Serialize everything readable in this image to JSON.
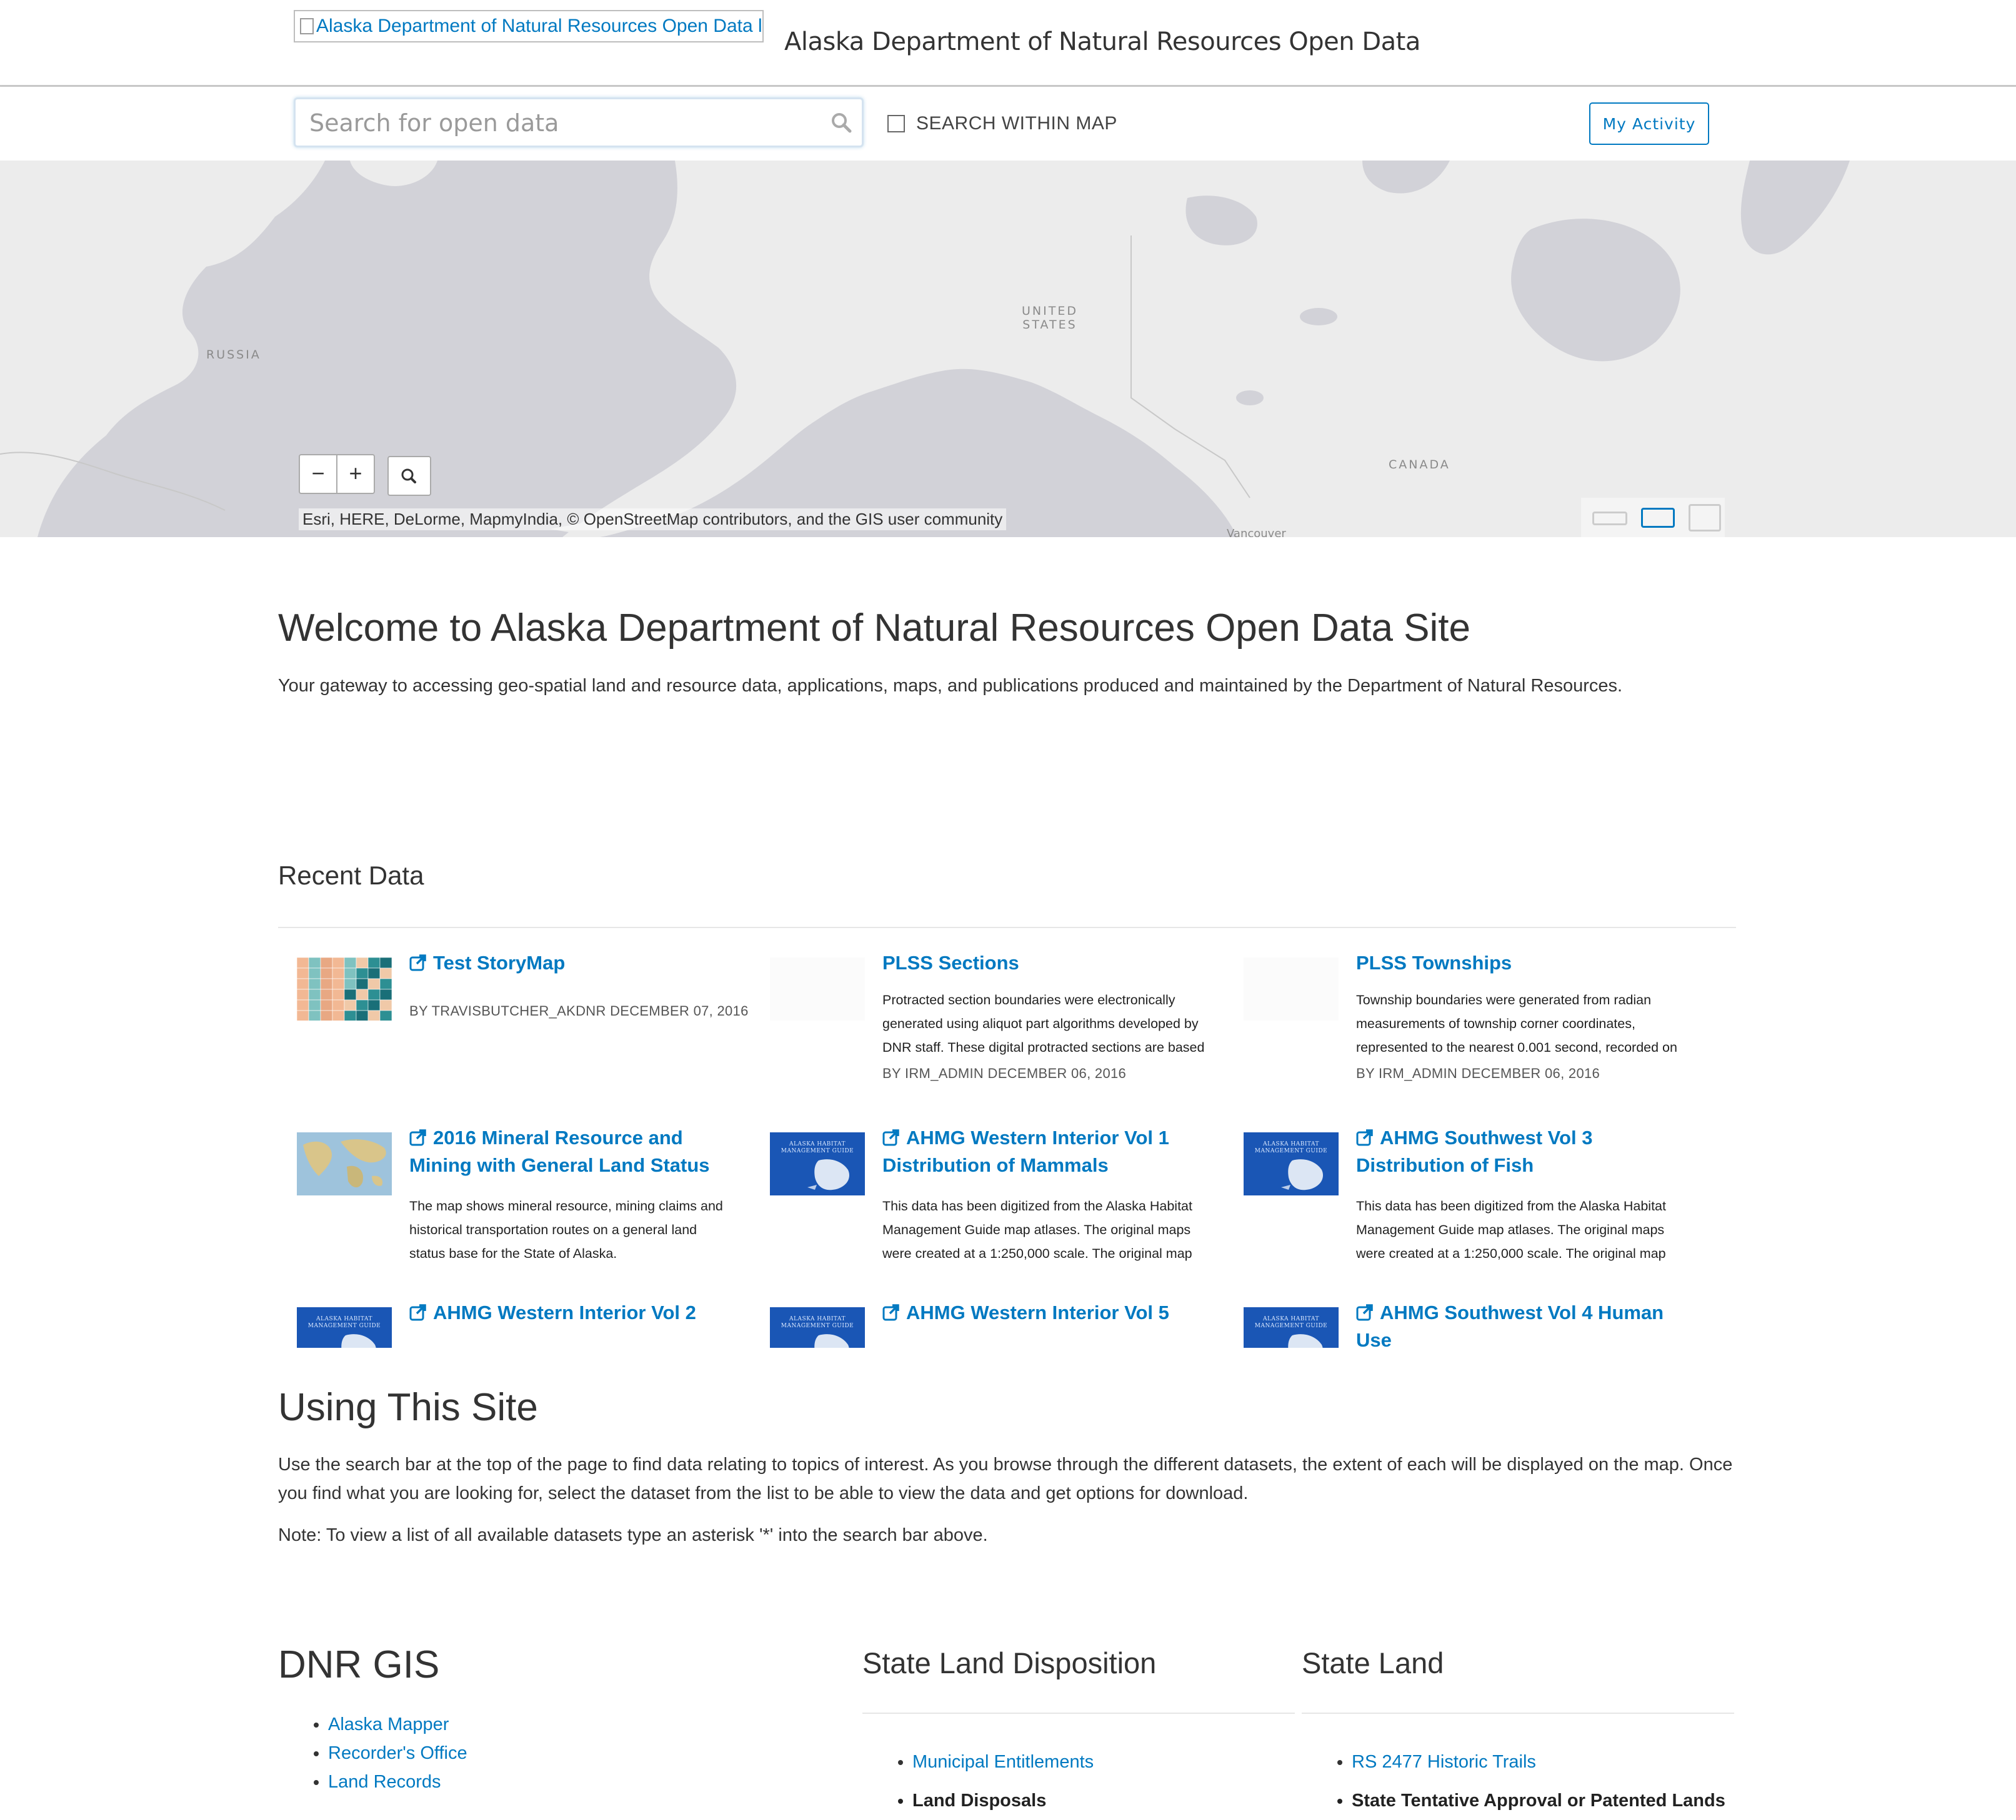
{
  "header": {
    "logo_alt": "Alaska Department of Natural Resources Open Data logo",
    "site_title": "Alaska Department of Natural Resources Open Data"
  },
  "search": {
    "placeholder": "Search for open data",
    "within_map_label": "SEARCH WITHIN MAP",
    "within_map_checked": false,
    "my_activity_label": "My Activity"
  },
  "map": {
    "labels": {
      "russia": "RUSSIA",
      "united_states": "UNITED STATES",
      "canada": "CANADA",
      "vancouver": "Vancouver"
    },
    "zoom_out": "−",
    "zoom_in": "+",
    "attribution": "Esri, HERE, DeLorme, MapmyIndia, © OpenStreetMap contributors, and the GIS user community",
    "water_color": "#d2d2d8",
    "land_color": "#ececec"
  },
  "welcome": {
    "title": "Welcome to Alaska Department of Natural Resources Open Data Site",
    "text": "Your gateway to accessing geo-spatial land and resource data, applications, maps, and publications produced and maintained by the Department of Natural Resources."
  },
  "recent": {
    "title": "Recent Data",
    "items": [
      {
        "title": "Test StoryMap",
        "description": "",
        "meta": "BY TRAVISBUTCHER_AKDNR DECEMBER 07, 2016",
        "thumb": "storymap",
        "external": true
      },
      {
        "title": "PLSS Sections",
        "description": "Protracted section boundaries were electronically generated using aliquot part algorithms developed by DNR staff. These digital protracted sections are based",
        "meta": "BY IRM_ADMIN DECEMBER 06, 2016",
        "thumb": "blank",
        "external": false
      },
      {
        "title": "PLSS Townships",
        "description": "Township boundaries were generated from radian measurements of township corner coordinates, represented to the nearest 0.001 second, recorded on",
        "meta": "BY IRM_ADMIN DECEMBER 06, 2016",
        "thumb": "blank",
        "external": false
      },
      {
        "title": "2016 Mineral Resource and Mining with General Land Status",
        "description": "The map shows mineral resource, mining claims and historical transportation routes on a general land status base for the State of Alaska.",
        "meta": "",
        "thumb": "world",
        "external": true
      },
      {
        "title": "AHMG Western Interior Vol 1 Distribution of Mammals",
        "description": "This data has been digitized from the Alaska Habitat Management Guide map atlases. The original maps were created at a 1:250,000 scale. The original map",
        "meta": "",
        "thumb": "ahmg",
        "external": true
      },
      {
        "title": "AHMG Southwest Vol 3 Distribution of Fish",
        "description": "This data has been digitized from the Alaska Habitat Management Guide map atlases. The original maps were created at a 1:250,000 scale. The original map",
        "meta": "",
        "thumb": "ahmg",
        "external": true
      },
      {
        "title": "AHMG Western Interior Vol 2",
        "description": "",
        "meta": "",
        "thumb": "ahmg",
        "external": true
      },
      {
        "title": "AHMG Western Interior Vol 5",
        "description": "",
        "meta": "",
        "thumb": "ahmg",
        "external": true
      },
      {
        "title": "AHMG Southwest Vol 4 Human Use",
        "description": "",
        "meta": "",
        "thumb": "ahmg",
        "external": true
      }
    ],
    "ahmg_thumb_text": "ALASKA HABITAT MANAGEMENT GUIDE"
  },
  "using": {
    "title": "Using This Site",
    "text": "Use the search bar at the top of the page to find data relating to topics of interest. As you browse through the different datasets, the extent of each will be displayed on the map. Once you find what you are looking for, select the dataset from the list to be able to view the data and get options for download.",
    "note": "Note: To view a list of all available datasets type an asterisk '*' into the search bar above."
  },
  "dnr_gis": {
    "title": "DNR GIS",
    "links": [
      "Alaska Mapper",
      "Recorder's Office",
      "Land Records"
    ]
  },
  "state_land_disposition": {
    "title": "State Land Disposition",
    "links": [
      {
        "label": "Municipal Entitlements",
        "link": true
      },
      {
        "label": "Land Disposals",
        "link": false
      }
    ]
  },
  "state_land": {
    "title": "State Land",
    "links": [
      {
        "label": "RS 2477 Historic Trails",
        "link": true
      },
      {
        "label": "State Tentative Approval or Patented Lands",
        "link": false
      }
    ]
  }
}
